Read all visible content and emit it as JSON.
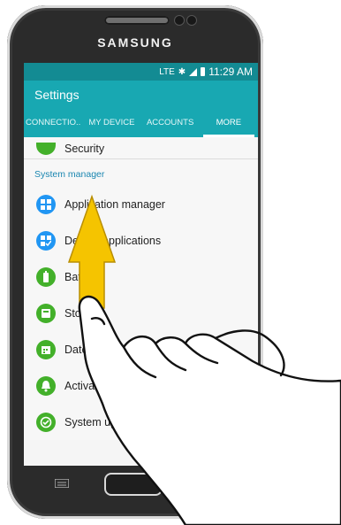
{
  "device": {
    "brand": "SAMSUNG"
  },
  "status_bar": {
    "network": "LTE",
    "time": "11:29 AM"
  },
  "app_bar": {
    "title": "Settings"
  },
  "tabs": [
    {
      "label": "CONNECTIO..",
      "active": false
    },
    {
      "label": "MY DEVICE",
      "active": false
    },
    {
      "label": "ACCOUNTS",
      "active": false
    },
    {
      "label": "MORE",
      "active": true
    }
  ],
  "list": {
    "top_item": {
      "label": "Security",
      "icon": "lock-icon"
    },
    "section_header": "System manager",
    "items": [
      {
        "label": "Application manager",
        "icon": "grid-icon",
        "icon_color": "#2196f3"
      },
      {
        "label": "Default applications",
        "icon": "grid-check-icon",
        "icon_color": "#2196f3"
      },
      {
        "label": "Battery",
        "icon": "battery-icon",
        "icon_color": "#43b02a"
      },
      {
        "label": "Storage",
        "icon": "storage-icon",
        "icon_color": "#43b02a"
      },
      {
        "label": "Date and time",
        "icon": "calendar-icon",
        "icon_color": "#43b02a"
      },
      {
        "label": "Activate this device",
        "icon": "alert-icon",
        "icon_color": "#43b02a"
      },
      {
        "label": "System update",
        "icon": "check-icon",
        "icon_color": "#43b02a"
      }
    ]
  },
  "colors": {
    "accent": "#18a8b2",
    "status_bar": "#138b93",
    "gesture_arrow": "#f5c400"
  },
  "gesture": {
    "type": "swipe-up",
    "icon": "swipe-up-arrow-icon"
  }
}
